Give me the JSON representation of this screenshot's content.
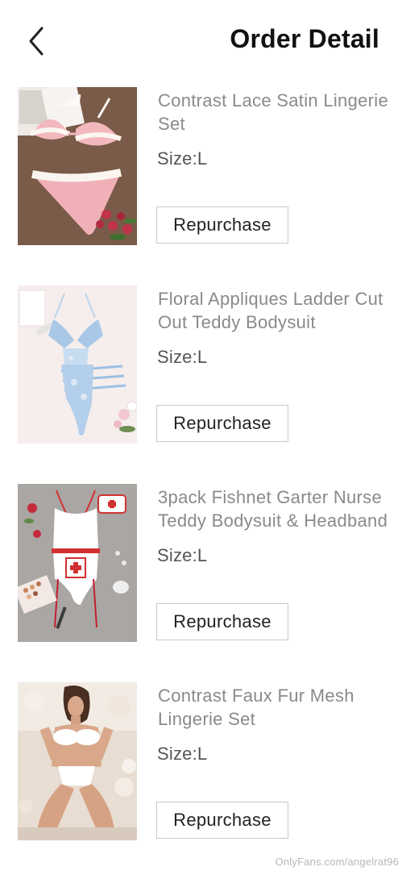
{
  "header": {
    "back_icon": "chevron-left-icon",
    "title": "Order Detail"
  },
  "items": [
    {
      "title_line1": "Contrast Lace Satin Lingerie",
      "title_line2": "Set",
      "size": "Size:L",
      "repurchase_label": "Repurchase",
      "image": "pink satin lace lingerie set"
    },
    {
      "title_line1": "Floral Appliques Ladder Cut",
      "title_line2": "Out Teddy Bodysuit",
      "size": "Size:L",
      "repurchase_label": "Repurchase",
      "image": "blue floral teddy bodysuit"
    },
    {
      "title_line1": "3pack Fishnet Garter Nurse",
      "title_line2": "Teddy Bodysuit & Headband",
      "size": "Size:L",
      "repurchase_label": "Repurchase",
      "image": "white red nurse teddy set"
    },
    {
      "title_line1": "Contrast Faux Fur Mesh",
      "title_line2": "Lingerie Set",
      "size": "Size:L",
      "repurchase_label": "Repurchase",
      "image": "model in white fur lingerie"
    }
  ],
  "watermark": "OnlyFans.com/angelrat96",
  "colors": {
    "title": "#111111",
    "item_text": "#8a8a8a",
    "size_text": "#555555",
    "button_border": "#c9c9c9"
  }
}
